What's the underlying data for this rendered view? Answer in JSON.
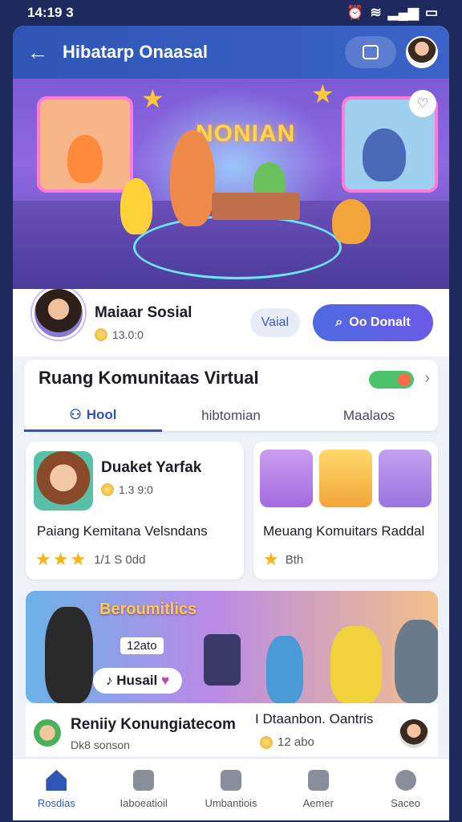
{
  "status": {
    "time": "14:19 3",
    "icons": [
      "alarm-icon",
      "wifi-icon",
      "signal-icon",
      "battery-icon"
    ]
  },
  "appbar": {
    "title": "Hibatarp Onaasal",
    "back_icon": "arrow-left-icon",
    "action_icon": "calendar-icon"
  },
  "hero": {
    "sign_text": "NONIAN",
    "favorite_icon": "heart-icon"
  },
  "profile": {
    "name": "Maiaar Sosial",
    "meta": "13.0:0",
    "visit_label": "Vaial",
    "main_button_label": "Oo Donalt"
  },
  "community": {
    "title": "Ruang Komunitaas Virtual",
    "tabs": [
      "Hool",
      "hibtomian",
      "Maalaos"
    ],
    "active_tab": 0
  },
  "cards": [
    {
      "name": "Duaket Yarfak",
      "meta": "1.3 9:0",
      "text": "Paiang Kemitana Velsndans",
      "rating_text": "1/1 S 0dd",
      "stars": 3
    },
    {
      "text": "Meuang Komuitars Raddal",
      "rating_text": "Bth",
      "stars": 1
    }
  ],
  "banner": {
    "title": "Beroumitlics",
    "small_label": "12ato",
    "button_label": "Husail"
  },
  "post": {
    "name": "Reniiy Konungiatecom",
    "subtitle": "Dk8 sonson",
    "right_title": "I Dtaanbon. Oantris",
    "right_meta": "12 abo"
  },
  "nav": {
    "items": [
      {
        "label": "Rosdias",
        "icon": "home-icon"
      },
      {
        "label": "Iaboeatioil",
        "icon": "chat-icon"
      },
      {
        "label": "Umbantiois",
        "icon": "leaf-icon"
      },
      {
        "label": "Aemer",
        "icon": "notification-icon"
      },
      {
        "label": "Saceo",
        "icon": "profile-icon"
      }
    ],
    "active": 0
  },
  "colors": {
    "accent": "#2f56b6",
    "background": "#1e2a5e",
    "star": "#f6b21a"
  }
}
